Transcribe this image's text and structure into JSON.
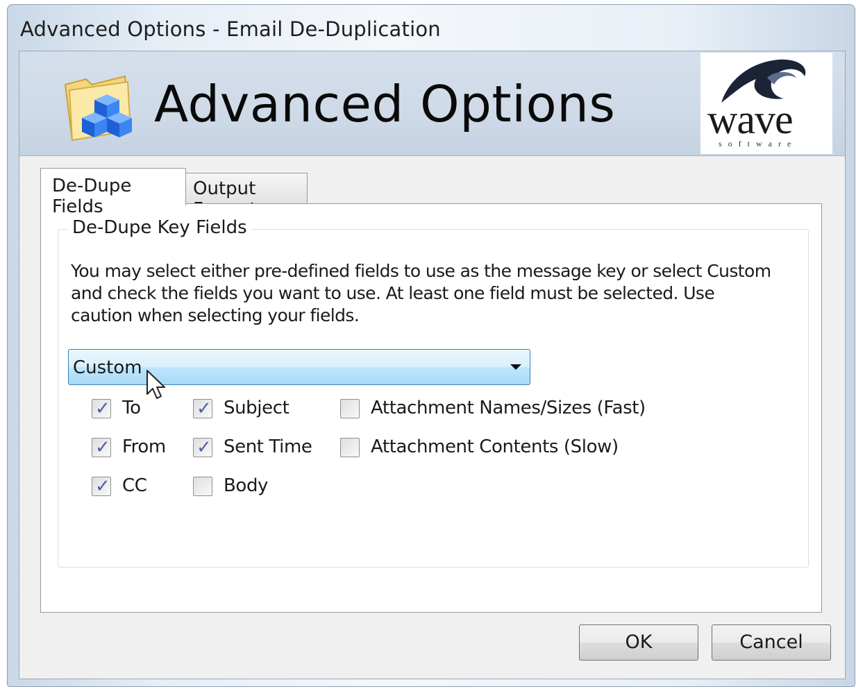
{
  "window": {
    "title": "Advanced Options - Email De-Duplication"
  },
  "banner": {
    "title": "Advanced Options",
    "icon": "folder-cubes-icon",
    "logo": {
      "word": "wave",
      "sub": "software"
    }
  },
  "tabs": [
    {
      "label": "De-Dupe Fields",
      "active": true
    },
    {
      "label": "Output Format",
      "active": false
    }
  ],
  "group": {
    "title": "De-Dupe Key Fields",
    "description": "You may select either pre-defined fields to use as the message key or  select Custom and check the fields you want to use. At least one field must be selected.  Use caution when selecting your fields.",
    "combo": {
      "value": "Custom"
    },
    "checkboxes": [
      {
        "label": "To",
        "checked": true
      },
      {
        "label": "From",
        "checked": true
      },
      {
        "label": "CC",
        "checked": true
      },
      {
        "label": "Subject",
        "checked": true
      },
      {
        "label": "Sent Time",
        "checked": true
      },
      {
        "label": "Body",
        "checked": false
      },
      {
        "label": "Attachment Names/Sizes (Fast)",
        "checked": false
      },
      {
        "label": "Attachment Contents (Slow)",
        "checked": false
      }
    ]
  },
  "buttons": {
    "ok": "OK",
    "cancel": "Cancel"
  }
}
